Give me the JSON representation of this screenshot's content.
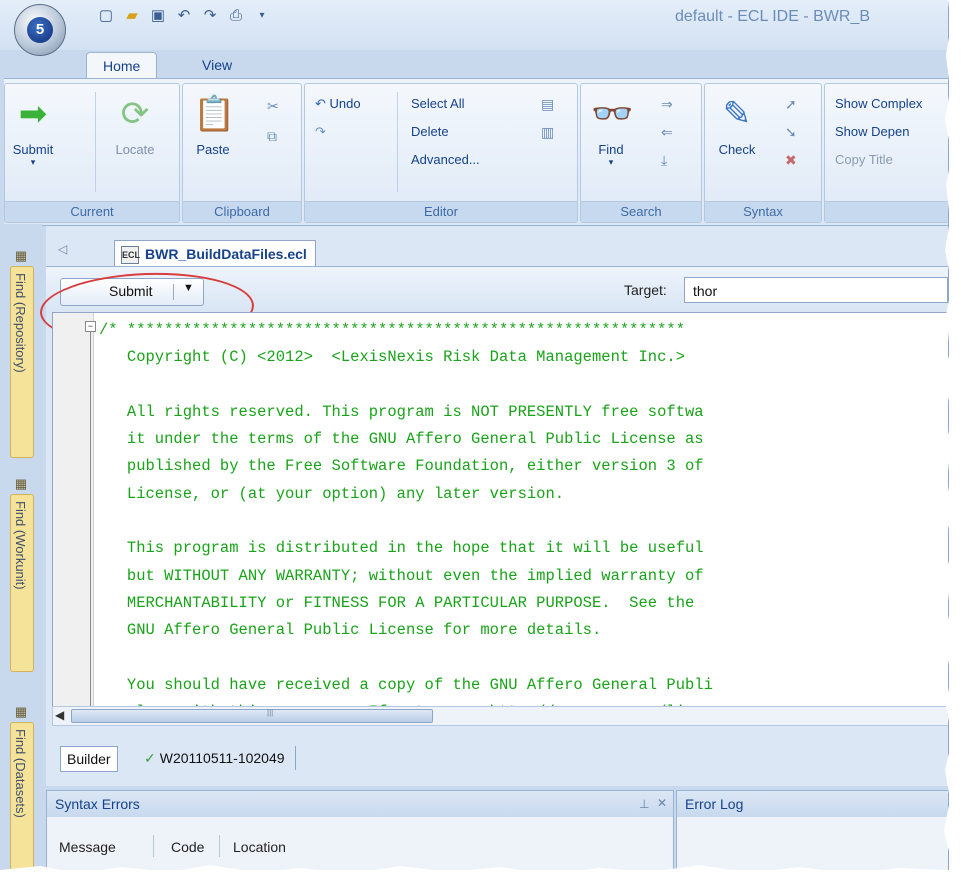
{
  "app": {
    "title": "default - ECL IDE - BWR_B",
    "orb_badge": "5"
  },
  "qat": {
    "icons": [
      "new-icon",
      "open-icon",
      "save-icon",
      "undo-icon",
      "redo-icon",
      "print-icon",
      "dropdown-icon"
    ]
  },
  "ribbon_tabs": [
    {
      "label": "Home",
      "active": true
    },
    {
      "label": "View",
      "active": false
    }
  ],
  "ribbon": {
    "current": {
      "label": "Current",
      "submit": "Submit",
      "locate": "Locate"
    },
    "clipboard": {
      "label": "Clipboard",
      "paste": "Paste"
    },
    "editor": {
      "label": "Editor",
      "undo": "Undo",
      "select_all": "Select All",
      "delete": "Delete",
      "advanced": "Advanced..."
    },
    "search": {
      "label": "Search",
      "find": "Find"
    },
    "syntax": {
      "label": "Syntax",
      "check": "Check"
    },
    "extra": {
      "show_complex": "Show Complex",
      "show_depend": "Show Depen",
      "copy_title": "Copy Title"
    }
  },
  "dock": {
    "tabs": [
      "Find (Repository)",
      "Find (Workunit)",
      "Find (Datasets)"
    ]
  },
  "document": {
    "tab_label": "BWR_BuildDataFiles.ecl",
    "file_icon_text": "ECL",
    "submit_label": "Submit",
    "target_label": "Target:",
    "target_value": "thor",
    "code_lines": [
      "/* ************************************************************",
      "   Copyright (C) <2012>  <LexisNexis Risk Data Management Inc.>",
      "",
      "   All rights reserved. This program is NOT PRESENTLY free softwa",
      "   it under the terms of the GNU Affero General Public License as",
      "   published by the Free Software Foundation, either version 3 of",
      "   License, or (at your option) any later version.",
      "",
      "   This program is distributed in the hope that it will be useful",
      "   but WITHOUT ANY WARRANTY; without even the implied warranty of",
      "   MERCHANTABILITY or FITNESS FOR A PARTICULAR PURPOSE.  See the",
      "   GNU Affero General Public License for more details.",
      "",
      "   You should have received a copy of the GNU Affero General Publi",
      "   along with this program.  If not, see <http://www.gnu.org/licen"
    ],
    "code_color": "#19a319"
  },
  "bottom_tabs": {
    "builder": "Builder",
    "workunit": "W20110511-102049"
  },
  "panels": {
    "syntax_errors": {
      "title": "Syntax Errors",
      "columns": [
        "Message",
        "Code",
        "Location"
      ]
    },
    "error_log": {
      "title": "Error Log"
    }
  },
  "colors": {
    "ribbon_text": "#15428b",
    "frame": "#c9d9ed",
    "annotation": "#d83c3c"
  }
}
